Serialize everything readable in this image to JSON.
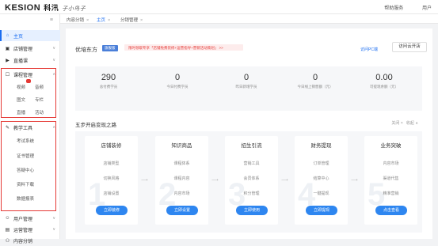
{
  "header": {
    "brand": "KESION",
    "brand_cn": "科汛",
    "signature": "子小鸟子",
    "menu1": "帮助服务",
    "menu2": "用户"
  },
  "sidebar": {
    "items": [
      {
        "label": "主页",
        "icon": "home-icon"
      },
      {
        "label": "店铺管理",
        "icon": "store-icon"
      },
      {
        "label": "直播课",
        "icon": "live-icon"
      },
      {
        "label": "课程管理",
        "icon": "course-icon"
      },
      {
        "label": "教学工具",
        "icon": "tools-icon"
      },
      {
        "label": "用户管理",
        "icon": "user-icon"
      },
      {
        "label": "运营管理",
        "icon": "operation-icon"
      },
      {
        "label": "内容分销",
        "icon": "distribution-icon"
      }
    ],
    "course_sub": [
      "视频",
      "音频",
      "图文",
      "专栏",
      "直播",
      "活动"
    ],
    "tools_sub": [
      "考试系统",
      "证书管理",
      "答疑中心",
      "资料下载",
      "数据报表"
    ]
  },
  "tabs": [
    {
      "label": "内容分销",
      "close": "×"
    },
    {
      "label": "主页",
      "close": "×"
    },
    {
      "label": "分销管理",
      "close": "×"
    }
  ],
  "store": {
    "name": "优培东方",
    "tag": "旗舰版",
    "promo": "限时领取专享「店铺免费装修+运营指导+营销活动策划」 >>",
    "link_pc": "访问PC端",
    "btn_cloud": "访问云开店"
  },
  "stats": [
    {
      "value": "290",
      "label": "总付费学员"
    },
    {
      "value": "0",
      "label": "今日付费学员"
    },
    {
      "value": "0",
      "label": "昨日新增学员"
    },
    {
      "value": "0",
      "label": "今日线上销售额（元）"
    },
    {
      "value": "0.00",
      "label": "可提现余额（元）"
    }
  ],
  "steps": {
    "title": "五步开启变现之路",
    "close_label": "关闭",
    "collapse_label": "收起",
    "items": [
      {
        "title": "店铺装修",
        "items": [
          "店铺类型",
          "切换风格",
          "店铺设置"
        ],
        "button": "立即装修",
        "num": "1"
      },
      {
        "title": "知识商品",
        "items": [
          "课程体系",
          "课程内容",
          "内容市场"
        ],
        "button": "立即设置",
        "num": "2"
      },
      {
        "title": "招生引流",
        "items": [
          "营销工具",
          "会员体系",
          "积分管理"
        ],
        "button": "立即使用",
        "num": "3"
      },
      {
        "title": "财务提现",
        "items": [
          "订单管理",
          "结算中心",
          "一键提现"
        ],
        "button": "立即提现",
        "num": "4"
      },
      {
        "title": "业务突破",
        "items": [
          "内容市场",
          "渠道代售",
          "精准营销"
        ],
        "button": "点击查看",
        "num": "5"
      }
    ]
  },
  "colors": {
    "accent": "#1a6cf0",
    "button": "#2e86f0",
    "highlight": "#e53935"
  }
}
